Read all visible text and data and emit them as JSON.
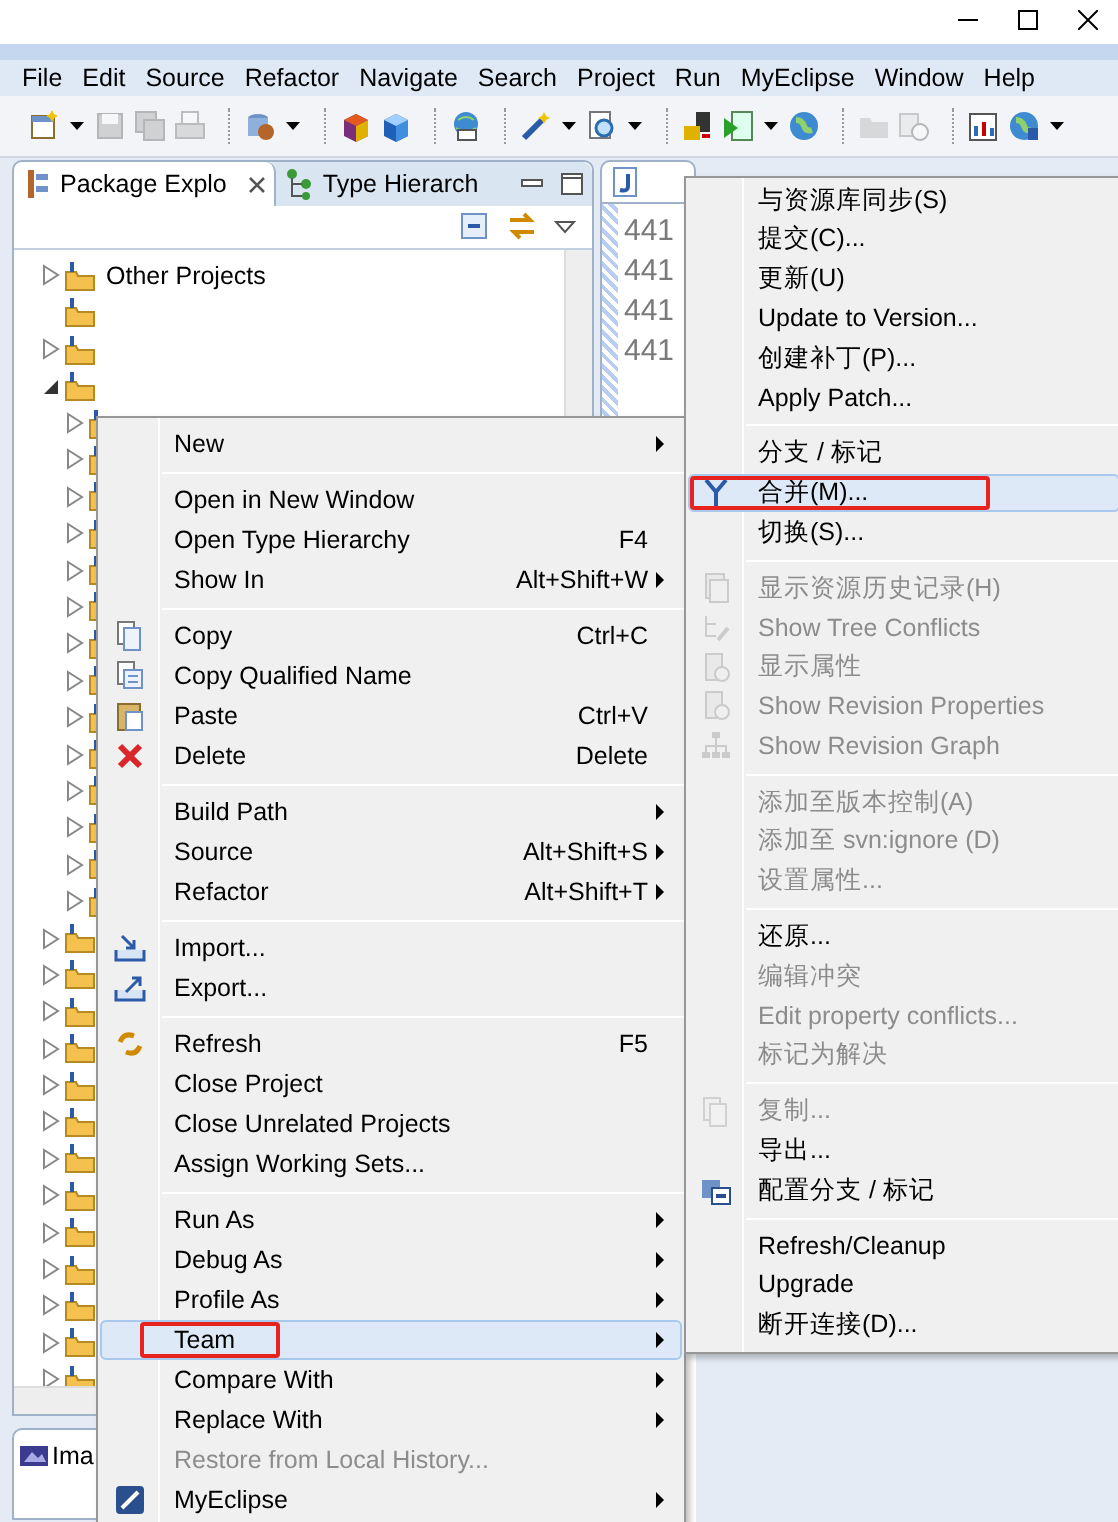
{
  "menubar": [
    "File",
    "Edit",
    "Source",
    "Refactor",
    "Navigate",
    "Search",
    "Project",
    "Run",
    "MyEclipse",
    "Window",
    "Help"
  ],
  "toolbar": [
    {
      "kind": "dropdown",
      "disabled": false
    },
    {
      "kind": "button",
      "disabled": true
    },
    {
      "kind": "button",
      "disabled": true
    },
    {
      "kind": "button",
      "disabled": true
    },
    {
      "kind": "separator"
    },
    {
      "kind": "dropdown",
      "disabled": false
    },
    {
      "kind": "separator"
    },
    {
      "kind": "button",
      "disabled": false
    },
    {
      "kind": "button",
      "disabled": false
    },
    {
      "kind": "separator"
    },
    {
      "kind": "button",
      "disabled": false
    },
    {
      "kind": "separator"
    },
    {
      "kind": "dropdown",
      "disabled": false
    },
    {
      "kind": "dropdown",
      "disabled": false
    },
    {
      "kind": "separator"
    },
    {
      "kind": "button",
      "disabled": false
    },
    {
      "kind": "dropdown",
      "disabled": false
    },
    {
      "kind": "button",
      "disabled": false
    },
    {
      "kind": "separator"
    },
    {
      "kind": "button",
      "disabled": true
    },
    {
      "kind": "button",
      "disabled": true
    },
    {
      "kind": "separator"
    },
    {
      "kind": "button",
      "disabled": false
    },
    {
      "kind": "dropdown",
      "disabled": false
    }
  ],
  "views": [
    {
      "label": "Package Explo",
      "selected": true
    },
    {
      "label": "Type Hierarch",
      "selected": false
    }
  ],
  "tree": [
    {
      "label": "Other Projects",
      "expanded": false
    },
    {
      "kind": "leaf"
    },
    {
      "expanded": false
    },
    {
      "expanded": true,
      "children": [
        {
          "expanded": false
        },
        {
          "expanded": false
        },
        {
          "expanded": false
        },
        {
          "expanded": false
        },
        {
          "expanded": false
        },
        {
          "expanded": false
        },
        {
          "expanded": false
        },
        {
          "expanded": false
        },
        {
          "expanded": false
        },
        {
          "expanded": false
        },
        {
          "expanded": false
        },
        {
          "expanded": false
        },
        {
          "expanded": false
        },
        {
          "expanded": false
        }
      ]
    },
    {
      "expanded": false
    },
    {
      "expanded": false
    },
    {
      "expanded": false
    },
    {
      "expanded": false
    },
    {
      "expanded": false
    },
    {
      "expanded": false
    },
    {
      "expanded": false
    },
    {
      "expanded": false
    },
    {
      "expanded": false
    },
    {
      "expanded": false
    },
    {
      "expanded": false
    },
    {
      "expanded": false
    },
    {
      "expanded": false
    }
  ],
  "editor": {
    "line_numbers": [
      "441",
      "441",
      "441",
      "441"
    ]
  },
  "bottom_view": {
    "label": "Ima"
  },
  "context_menu": {
    "items": [
      {
        "kind": "item",
        "label": "New",
        "submenu": true,
        "disabled": false,
        "selected": false
      },
      {
        "kind": "separator"
      },
      {
        "kind": "item",
        "label": "Open in New Window",
        "disabled": false,
        "selected": false
      },
      {
        "kind": "item",
        "label": "Open Type Hierarchy",
        "shortcut": "F4",
        "disabled": false,
        "selected": false
      },
      {
        "kind": "item",
        "label": "Show In",
        "shortcut": "Alt+Shift+W",
        "submenu": true,
        "disabled": false,
        "selected": false
      },
      {
        "kind": "separator"
      },
      {
        "kind": "item",
        "label": "Copy",
        "shortcut": "Ctrl+C",
        "disabled": false,
        "selected": false
      },
      {
        "kind": "item",
        "label": "Copy Qualified Name",
        "disabled": false,
        "selected": false
      },
      {
        "kind": "item",
        "label": "Paste",
        "shortcut": "Ctrl+V",
        "disabled": false,
        "selected": false
      },
      {
        "kind": "item",
        "label": "Delete",
        "shortcut": "Delete",
        "disabled": false,
        "selected": false
      },
      {
        "kind": "separator"
      },
      {
        "kind": "item",
        "label": "Build Path",
        "submenu": true,
        "disabled": false,
        "selected": false
      },
      {
        "kind": "item",
        "label": "Source",
        "shortcut": "Alt+Shift+S",
        "submenu": true,
        "disabled": false,
        "selected": false
      },
      {
        "kind": "item",
        "label": "Refactor",
        "shortcut": "Alt+Shift+T",
        "submenu": true,
        "disabled": false,
        "selected": false
      },
      {
        "kind": "separator"
      },
      {
        "kind": "item",
        "label": "Import...",
        "disabled": false,
        "selected": false
      },
      {
        "kind": "item",
        "label": "Export...",
        "disabled": false,
        "selected": false
      },
      {
        "kind": "separator"
      },
      {
        "kind": "item",
        "label": "Refresh",
        "shortcut": "F5",
        "disabled": false,
        "selected": false
      },
      {
        "kind": "item",
        "label": "Close Project",
        "disabled": false,
        "selected": false
      },
      {
        "kind": "item",
        "label": "Close Unrelated Projects",
        "disabled": false,
        "selected": false
      },
      {
        "kind": "item",
        "label": "Assign Working Sets...",
        "disabled": false,
        "selected": false
      },
      {
        "kind": "separator"
      },
      {
        "kind": "item",
        "label": "Run As",
        "submenu": true,
        "disabled": false,
        "selected": false
      },
      {
        "kind": "item",
        "label": "Debug As",
        "submenu": true,
        "disabled": false,
        "selected": false
      },
      {
        "kind": "item",
        "label": "Profile As",
        "submenu": true,
        "disabled": false,
        "selected": false
      },
      {
        "kind": "item",
        "label": "Team",
        "submenu": true,
        "disabled": false,
        "selected": true,
        "annotated": true
      },
      {
        "kind": "item",
        "label": "Compare With",
        "submenu": true,
        "disabled": false,
        "selected": false
      },
      {
        "kind": "item",
        "label": "Replace With",
        "submenu": true,
        "disabled": false,
        "selected": false
      },
      {
        "kind": "item",
        "label": "Restore from Local History...",
        "disabled": true,
        "selected": false
      },
      {
        "kind": "item",
        "label": "MyEclipse",
        "submenu": true,
        "disabled": false,
        "selected": false
      }
    ]
  },
  "team_menu": {
    "items": [
      {
        "kind": "item",
        "label": "与资源库同步(S)",
        "disabled": false,
        "selected": false
      },
      {
        "kind": "item",
        "label": "提交(C)...",
        "disabled": false,
        "selected": false
      },
      {
        "kind": "item",
        "label": "更新(U)",
        "disabled": false,
        "selected": false
      },
      {
        "kind": "item",
        "label": "Update to Version...",
        "disabled": false,
        "selected": false
      },
      {
        "kind": "item",
        "label": "创建补丁(P)...",
        "disabled": false,
        "selected": false
      },
      {
        "kind": "item",
        "label": "Apply Patch...",
        "disabled": false,
        "selected": false
      },
      {
        "kind": "separator"
      },
      {
        "kind": "item",
        "label": "分支 / 标记",
        "disabled": false,
        "selected": false
      },
      {
        "kind": "item",
        "label": "合并(M)...",
        "disabled": false,
        "selected": true,
        "annotated": true
      },
      {
        "kind": "item",
        "label": "切换(S)...",
        "disabled": false,
        "selected": false
      },
      {
        "kind": "separator"
      },
      {
        "kind": "item",
        "label": "显示资源历史记录(H)",
        "disabled": true,
        "selected": false
      },
      {
        "kind": "item",
        "label": "Show Tree Conflicts",
        "disabled": true,
        "selected": false
      },
      {
        "kind": "item",
        "label": "显示属性",
        "disabled": true,
        "selected": false
      },
      {
        "kind": "item",
        "label": "Show Revision Properties",
        "disabled": true,
        "selected": false
      },
      {
        "kind": "item",
        "label": "Show Revision Graph",
        "disabled": true,
        "selected": false
      },
      {
        "kind": "separator"
      },
      {
        "kind": "item",
        "label": "添加至版本控制(A)",
        "disabled": true,
        "selected": false
      },
      {
        "kind": "item",
        "label": "添加至 svn:ignore (D)",
        "disabled": true,
        "selected": false
      },
      {
        "kind": "item",
        "label": "设置属性...",
        "disabled": true,
        "selected": false
      },
      {
        "kind": "separator"
      },
      {
        "kind": "item",
        "label": "还原...",
        "disabled": false,
        "selected": false
      },
      {
        "kind": "item",
        "label": "编辑冲突",
        "disabled": true,
        "selected": false
      },
      {
        "kind": "item",
        "label": "Edit property conflicts...",
        "disabled": true,
        "selected": false
      },
      {
        "kind": "item",
        "label": "标记为解决",
        "disabled": true,
        "selected": false
      },
      {
        "kind": "separator"
      },
      {
        "kind": "item",
        "label": "复制...",
        "disabled": true,
        "selected": false
      },
      {
        "kind": "item",
        "label": "导出...",
        "disabled": false,
        "selected": false
      },
      {
        "kind": "item",
        "label": "配置分支 / 标记",
        "disabled": false,
        "selected": false
      },
      {
        "kind": "separator"
      },
      {
        "kind": "item",
        "label": "Refresh/Cleanup",
        "disabled": false,
        "selected": false
      },
      {
        "kind": "item",
        "label": "Upgrade",
        "disabled": false,
        "selected": false
      },
      {
        "kind": "item",
        "label": "断开连接(D)...",
        "disabled": false,
        "selected": false
      }
    ]
  }
}
